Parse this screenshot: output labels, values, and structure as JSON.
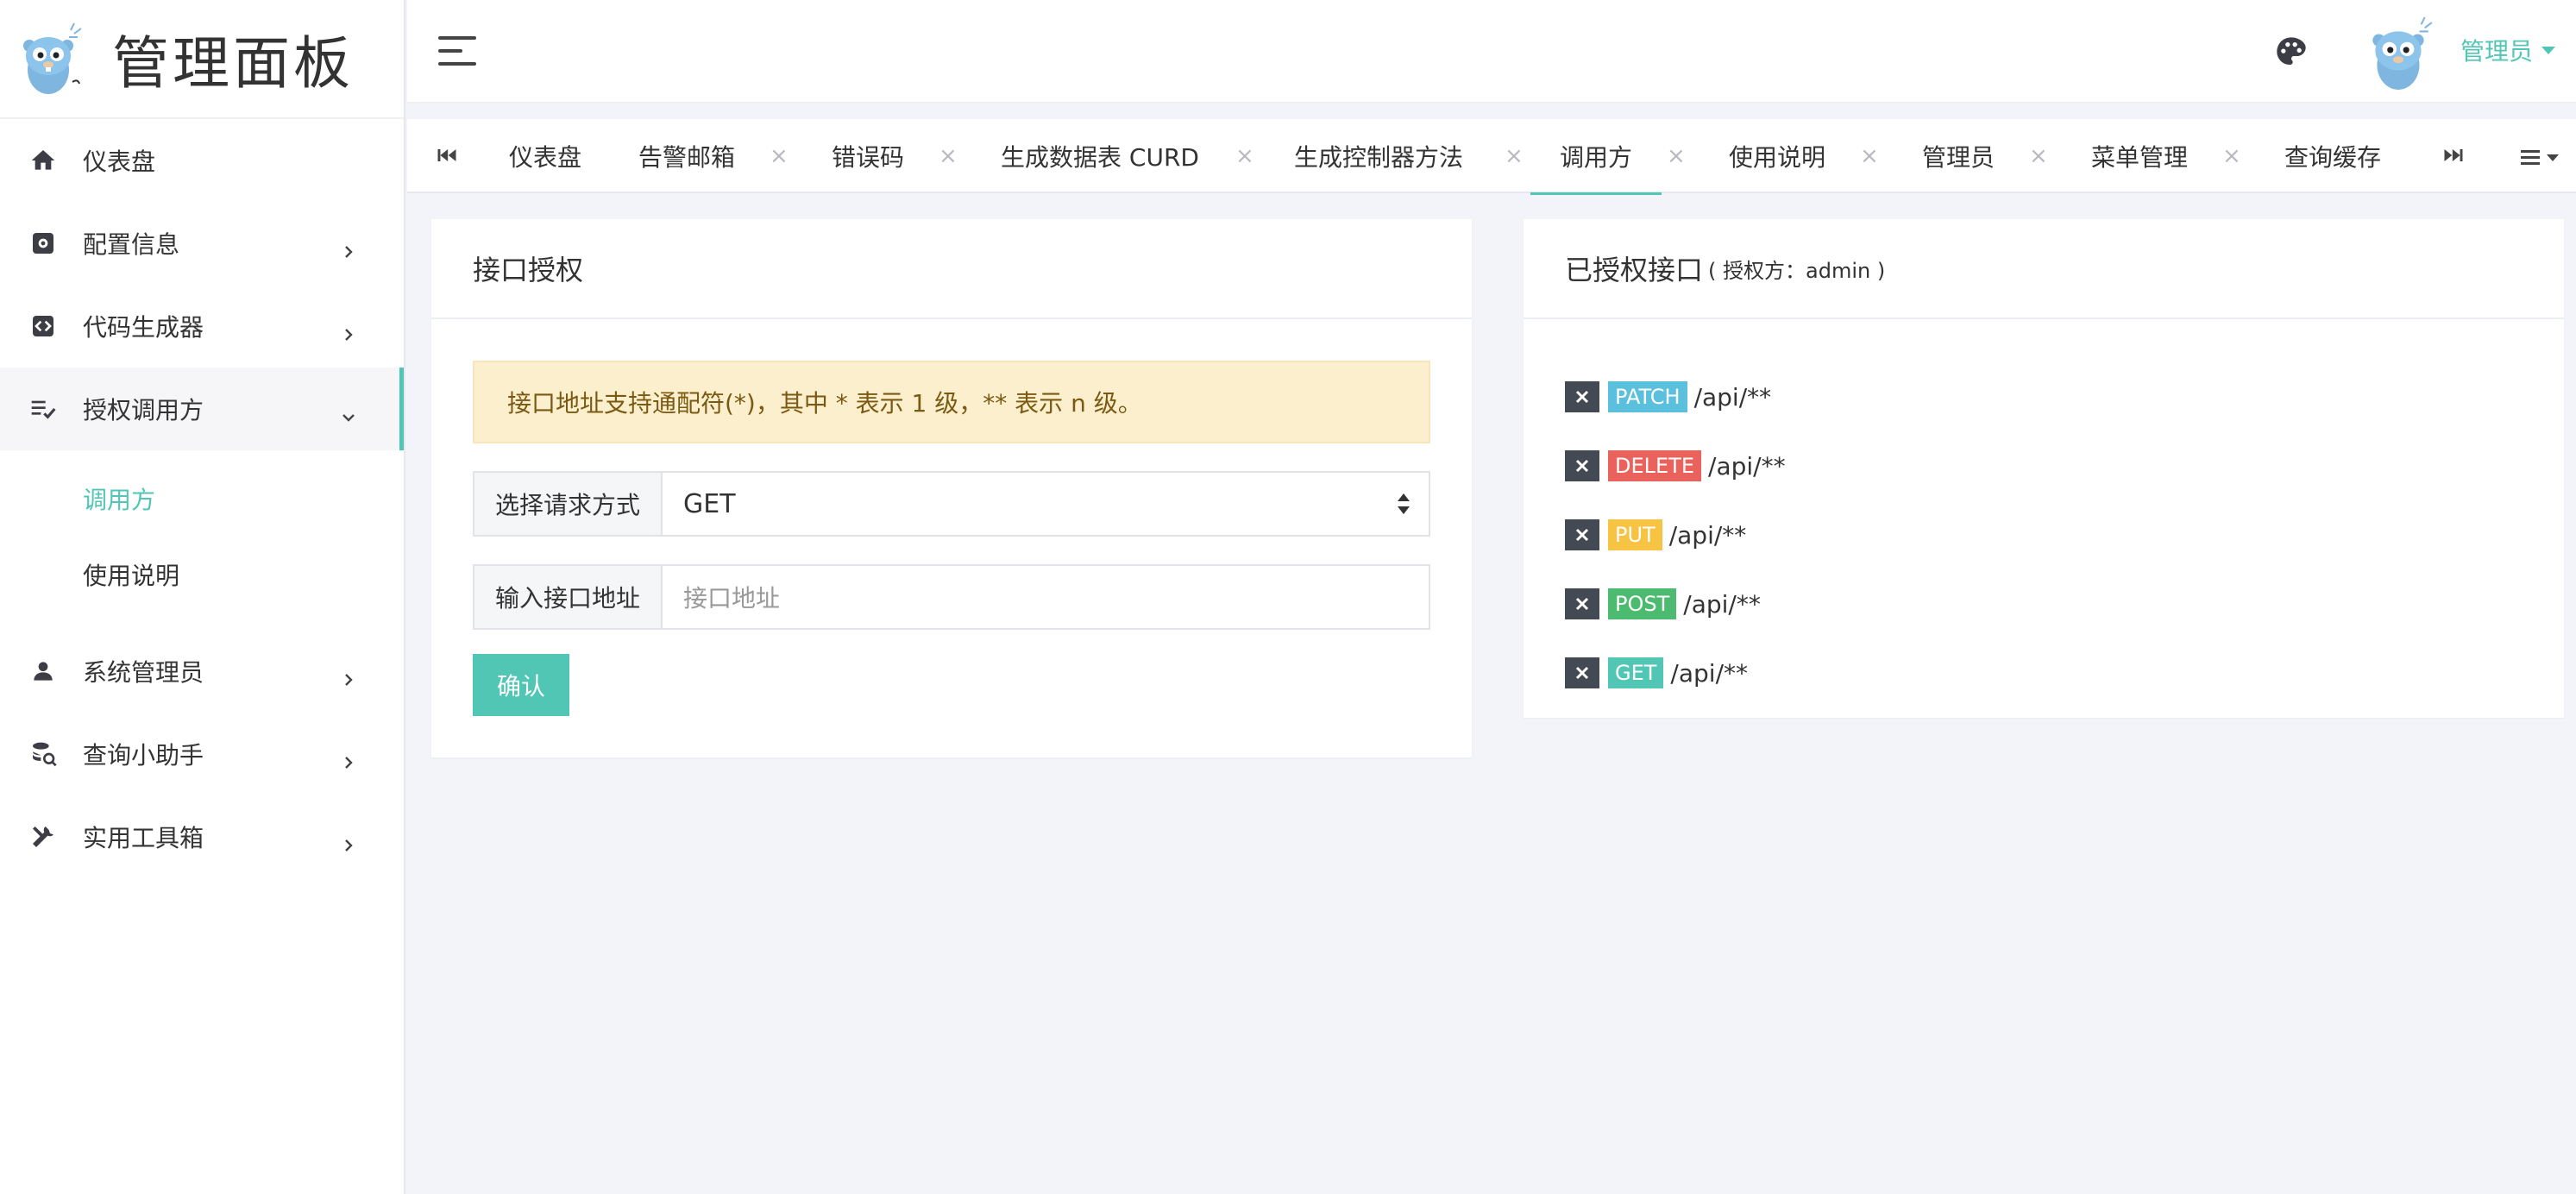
{
  "brand": {
    "title": "管理面板"
  },
  "sidebar": {
    "items": [
      {
        "label": "仪表盘",
        "icon": "home-icon"
      },
      {
        "label": "配置信息",
        "icon": "cog-icon"
      },
      {
        "label": "代码生成器",
        "icon": "code-icon"
      },
      {
        "label": "授权调用方",
        "icon": "list-check-icon"
      },
      {
        "label": "系统管理员",
        "icon": "user-icon"
      },
      {
        "label": "查询小助手",
        "icon": "database-search-icon"
      },
      {
        "label": "实用工具箱",
        "icon": "tools-icon"
      }
    ],
    "submenu": [
      {
        "label": "调用方",
        "active": true
      },
      {
        "label": "使用说明",
        "active": false
      }
    ]
  },
  "header": {
    "user_name": "管理员"
  },
  "tabs": [
    {
      "label": "仪表盘",
      "closable": false
    },
    {
      "label": "告警邮箱",
      "closable": true
    },
    {
      "label": "错误码",
      "closable": true
    },
    {
      "label": "生成数据表 CURD",
      "closable": true
    },
    {
      "label": "生成控制器方法",
      "closable": true
    },
    {
      "label": "调用方",
      "closable": true,
      "active": true
    },
    {
      "label": "使用说明",
      "closable": true
    },
    {
      "label": "管理员",
      "closable": true
    },
    {
      "label": "菜单管理",
      "closable": true
    },
    {
      "label": "查询缓存",
      "closable": false
    }
  ],
  "tab_close_glyph": "×",
  "form_card": {
    "title": "接口授权",
    "alert": "接口地址支持通配符(*)，其中 * 表示 1 级，** 表示 n 级。",
    "method_label": "选择请求方式",
    "method_value": "GET",
    "path_label": "输入接口地址",
    "path_placeholder": "接口地址",
    "confirm_label": "确认"
  },
  "list_card": {
    "title": "已授权接口",
    "subtitle": "( 授权方：admin )",
    "items": [
      {
        "method": "PATCH",
        "path": "/api/**",
        "color": "#5bc0de"
      },
      {
        "method": "DELETE",
        "path": "/api/**",
        "color": "#e9625b"
      },
      {
        "method": "PUT",
        "path": "/api/**",
        "color": "#f6c342"
      },
      {
        "method": "POST",
        "path": "/api/**",
        "color": "#4cba6f"
      },
      {
        "method": "GET",
        "path": "/api/**",
        "color": "#52c6b4"
      }
    ]
  },
  "colors": {
    "accent": "#52c6b4",
    "alert_bg": "#fcefcd",
    "delete_btn": "#434a54"
  }
}
